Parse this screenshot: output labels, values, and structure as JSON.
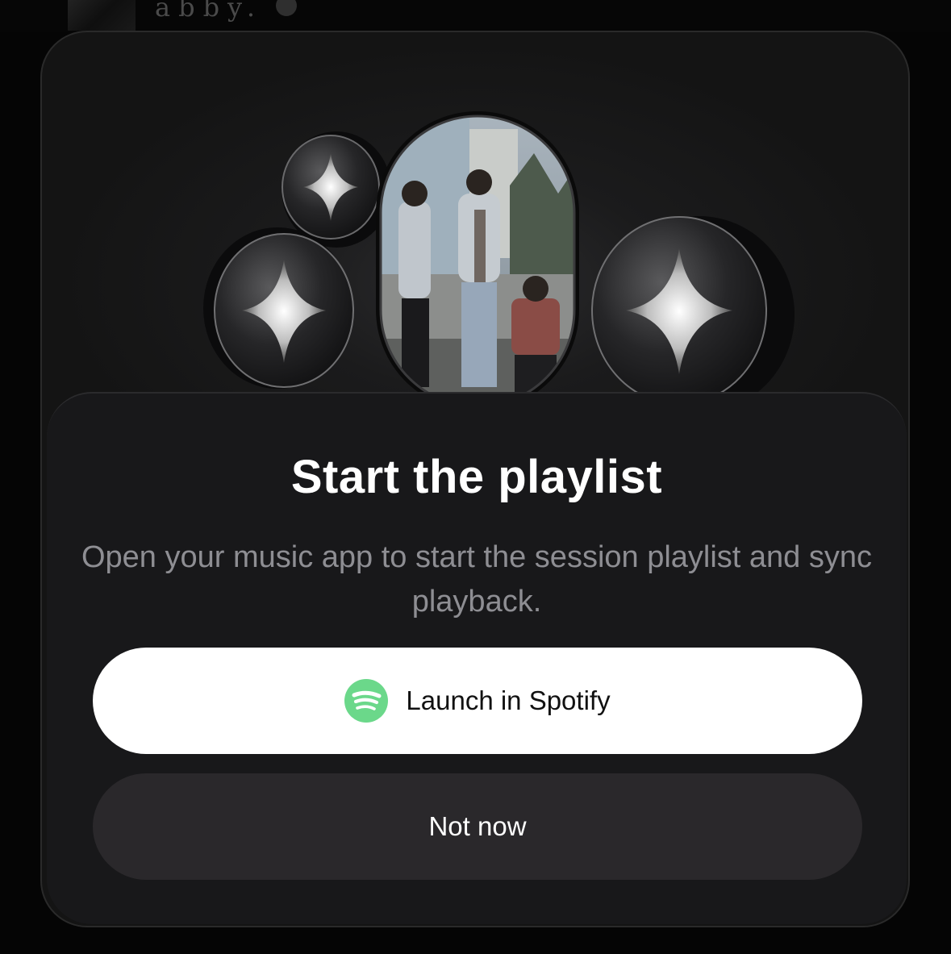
{
  "background": {
    "title_text": "abby."
  },
  "hero": {
    "image_description": "collage-art"
  },
  "dialog": {
    "title": "Start the playlist",
    "description": "Open your music app to start the session playlist and sync playback.",
    "primary_button": {
      "label": "Launch in Spotify",
      "icon": "spotify-icon"
    },
    "secondary_button": {
      "label": "Not now"
    }
  },
  "colors": {
    "spotify_green": "#1ed760",
    "primary_button_bg": "#ffffff",
    "secondary_button_bg": "#2a282b",
    "description_text": "#8e8e93"
  }
}
